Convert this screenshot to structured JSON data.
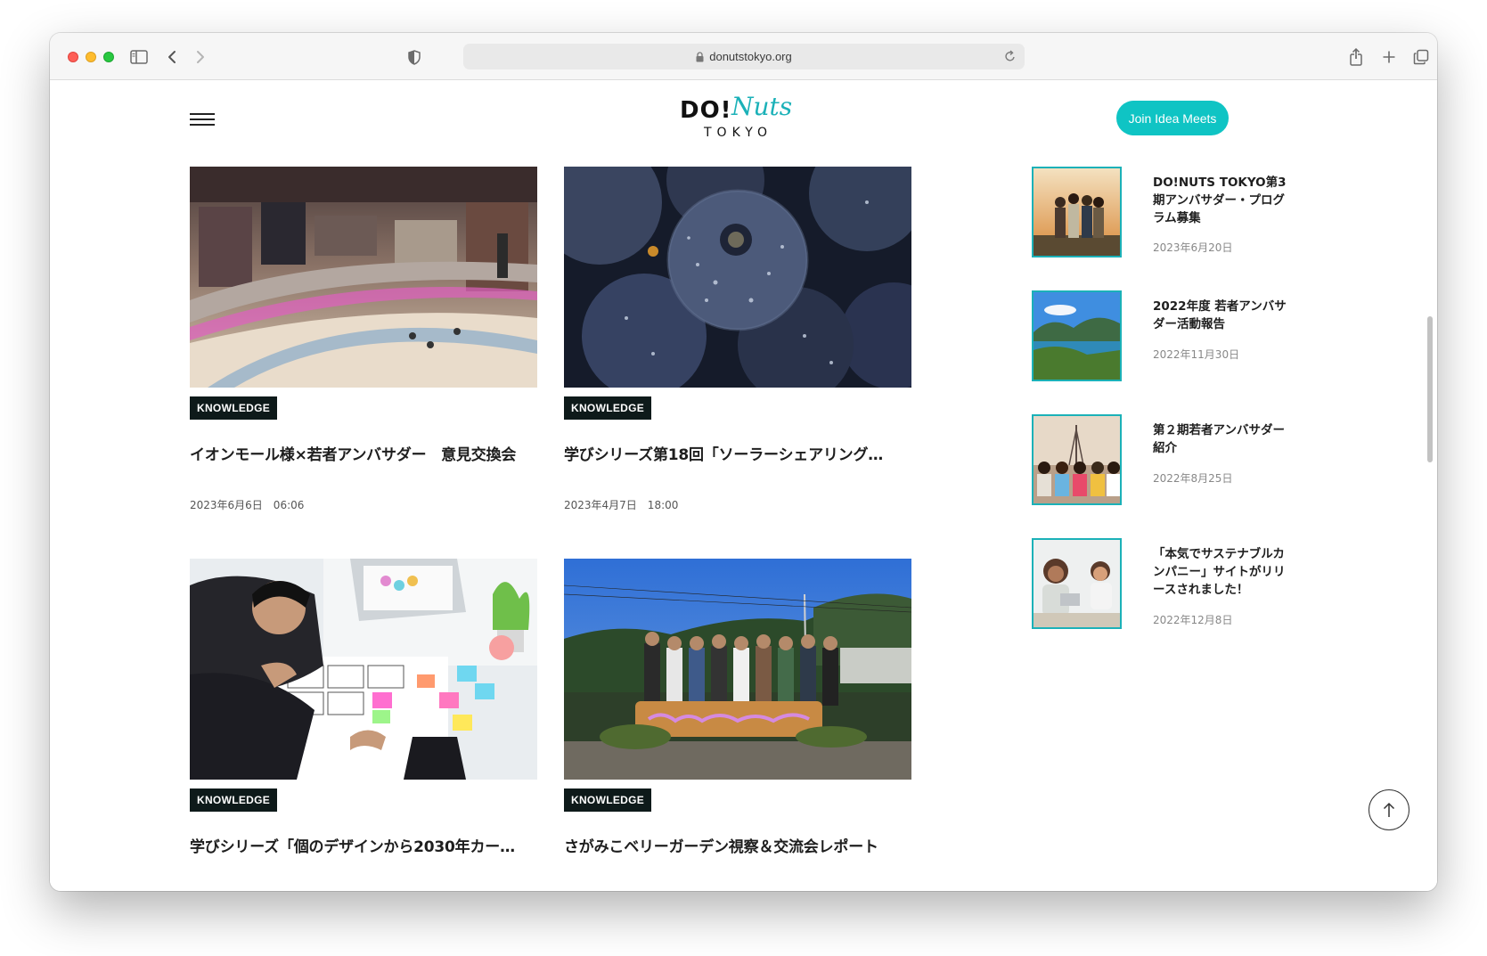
{
  "browser": {
    "url": "donutstokyo.org",
    "icons": [
      "sidebar-icon",
      "back-icon",
      "forward-icon",
      "shield-icon",
      "lock-icon",
      "reload-icon",
      "share-icon",
      "new-tab-icon",
      "tabs-icon"
    ]
  },
  "header": {
    "logo_main": "DO!",
    "logo_script": "Nuts",
    "logo_sub": "TOKYO",
    "join_button": "Join Idea Meets"
  },
  "articles": [
    {
      "tag": "KNOWLEDGE",
      "title": "イオンモール様×若者アンバサダー　意見交換会",
      "date": "2023年6月6日　06:06"
    },
    {
      "tag": "KNOWLEDGE",
      "title": "学びシリーズ第18回「ソーラーシェアリング…",
      "date": "2023年4月7日　18:00"
    },
    {
      "tag": "KNOWLEDGE",
      "title": "学びシリーズ「個のデザインから2030年カー…",
      "date": ""
    },
    {
      "tag": "KNOWLEDGE",
      "title": "さがみこベリーガーデン視察＆交流会レポート",
      "date": ""
    }
  ],
  "sidebar": [
    {
      "title": "DO!NUTS TOKYO第3期アンバサダー・プログラム募集",
      "date": "2023年6月20日"
    },
    {
      "title": "2022年度 若者アンバサダー活動報告",
      "date": "2022年11月30日"
    },
    {
      "title": "第２期若者アンバサダー紹介",
      "date": "2022年8月25日"
    },
    {
      "title": "「本気でサステナブルカンパニー」サイトがリリースされました！",
      "date": "2022年12月8日"
    }
  ],
  "colors": {
    "accent": "#0fc4c4",
    "tag_bg": "#0e1a1a",
    "thumb_border": "#1bb1b8"
  }
}
